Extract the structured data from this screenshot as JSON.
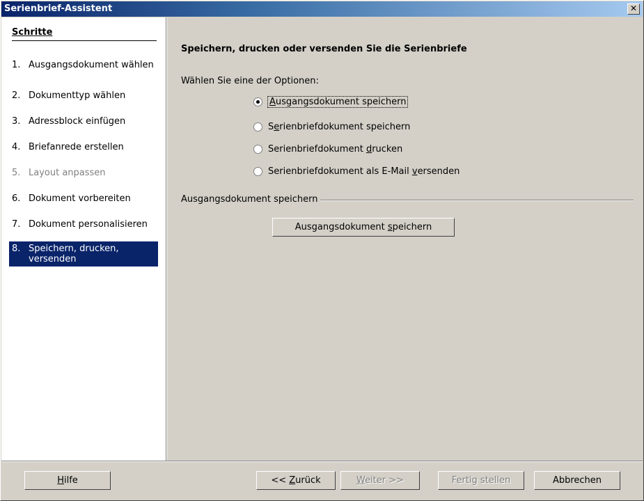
{
  "window": {
    "title": "Serienbrief-Assistent",
    "close_glyph": "✕"
  },
  "sidebar": {
    "heading": "Schritte",
    "steps": [
      {
        "num": "1.",
        "label": "Ausgangsdokument wählen",
        "state": "normal"
      },
      {
        "num": "2.",
        "label": "Dokumenttyp wählen",
        "state": "normal"
      },
      {
        "num": "3.",
        "label": "Adressblock einfügen",
        "state": "normal"
      },
      {
        "num": "4.",
        "label": "Briefanrede erstellen",
        "state": "normal"
      },
      {
        "num": "5.",
        "label": "Layout anpassen",
        "state": "disabled"
      },
      {
        "num": "6.",
        "label": "Dokument vorbereiten",
        "state": "normal"
      },
      {
        "num": "7.",
        "label": "Dokument personalisieren",
        "state": "normal"
      },
      {
        "num": "8.",
        "label": "Speichern, drucken, versenden",
        "state": "active"
      }
    ]
  },
  "main": {
    "title": "Speichern, drucken oder versenden Sie die Serienbriefe",
    "choose_label": "Wählen Sie eine der Optionen:",
    "options": [
      {
        "pre": "",
        "mn": "A",
        "post": "usgangsdokument speichern",
        "checked": true
      },
      {
        "pre": "S",
        "mn": "e",
        "post": "rienbriefdokument speichern",
        "checked": false
      },
      {
        "pre": "Serienbriefdokument ",
        "mn": "d",
        "post": "rucken",
        "checked": false
      },
      {
        "pre": "Serienbriefdokument als E-Mail ",
        "mn": "v",
        "post": "ersenden",
        "checked": false
      }
    ],
    "group_label": "Ausgangsdokument speichern",
    "save_button": {
      "pre": "Ausgangsdokument ",
      "mn": "s",
      "post": "peichern"
    }
  },
  "footer": {
    "help": {
      "pre": "",
      "mn": "H",
      "post": "ilfe"
    },
    "back": {
      "pre": "<< ",
      "mn": "Z",
      "post": "urück"
    },
    "next": {
      "pre": "",
      "mn": "W",
      "post": "eiter >>"
    },
    "finish": "Fertig stellen",
    "cancel": "Abbrechen"
  },
  "colors": {
    "title_bar": "#0a246a",
    "active_step_bg": "#0a246a",
    "dialog_bg": "#d4d0c8"
  }
}
